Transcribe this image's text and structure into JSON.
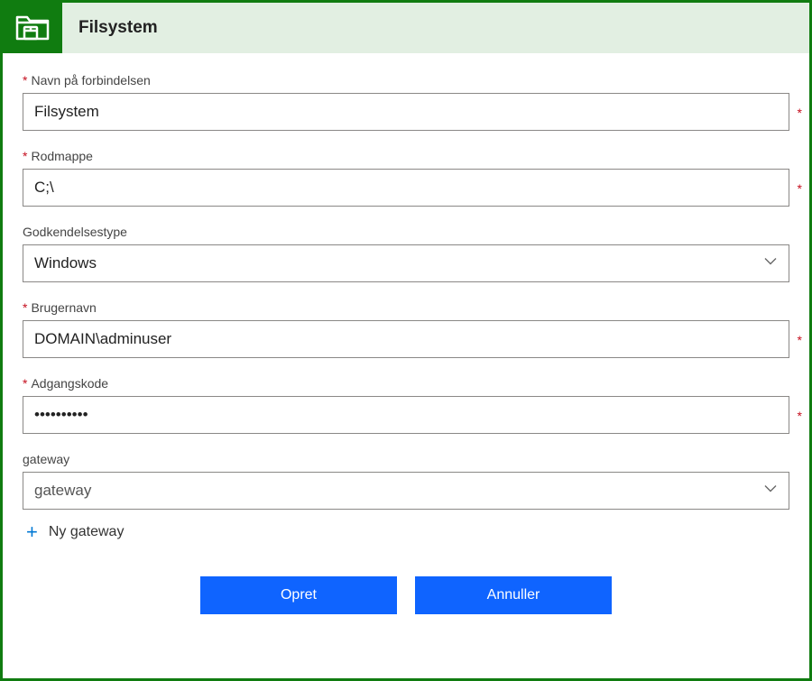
{
  "header": {
    "title": "Filsystem"
  },
  "fields": {
    "connection_name": {
      "label": "Navn på forbindelsen",
      "value": "Filsystem",
      "required": true
    },
    "root_folder": {
      "label": "Rodmappe",
      "value": "C;\\",
      "required": true
    },
    "auth_type": {
      "label": "Godkendelsestype",
      "value": "Windows",
      "required": false
    },
    "username": {
      "label": "Brugernavn",
      "value": "DOMAIN\\adminuser",
      "required": true
    },
    "password": {
      "label": "Adgangskode",
      "value": "••••••••••",
      "required": true
    },
    "gateway": {
      "label": "gateway",
      "value": "gateway",
      "required": false
    }
  },
  "new_gateway_label": "Ny gateway",
  "buttons": {
    "create": "Opret",
    "cancel": "Annuller"
  }
}
